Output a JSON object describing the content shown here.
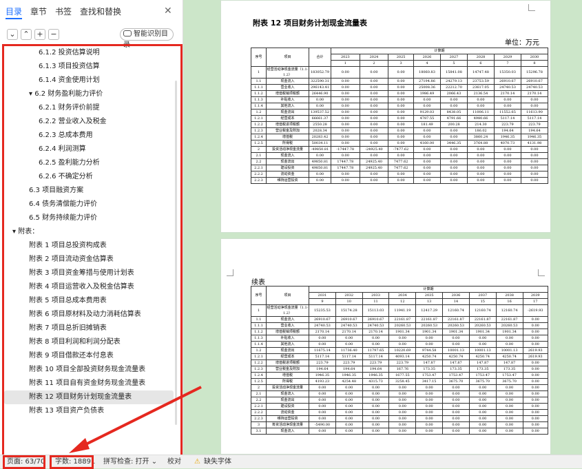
{
  "tabs": [
    "目录",
    "章节",
    "书签",
    "查找和替换"
  ],
  "tools": {
    "collapse": "⌄",
    "expand": "⌃",
    "add": "+",
    "remove": "−",
    "smart": "智能识别目录"
  },
  "outline": [
    {
      "t": "6.1.2 投资估算说明",
      "l": 3
    },
    {
      "t": "6.1.3 项目投资估算",
      "l": 3
    },
    {
      "t": "6.1.4 资金使用计划",
      "l": 3
    },
    {
      "t": "▾ 6.2 财务盈利能力评价",
      "l": 2
    },
    {
      "t": "6.2.1 财务评价前提",
      "l": 3
    },
    {
      "t": "6.2.2 营业收入及税金",
      "l": 3
    },
    {
      "t": "6.2.3 总成本费用",
      "l": 3
    },
    {
      "t": "6.2.4 利润测算",
      "l": 3
    },
    {
      "t": "6.2.5 盈利能力分析",
      "l": 3
    },
    {
      "t": "6.2.6 不确定分析",
      "l": 3
    },
    {
      "t": "6.3 项目融资方案",
      "l": 2
    },
    {
      "t": "6.4 债务清偿能力评价",
      "l": 2
    },
    {
      "t": "6.5 财务持续能力评价",
      "l": 2
    },
    {
      "t": "▾ 附表：",
      "l": 1
    },
    {
      "t": "附表 1 项目总投资构成表",
      "l": 2
    },
    {
      "t": "附表 2 项目流动资金估算表",
      "l": 2
    },
    {
      "t": "附表 3 项目资金筹措与使用计划表",
      "l": 2
    },
    {
      "t": "附表 4 项目运营收入及税金估算表",
      "l": 2
    },
    {
      "t": "附表 5 项目总成本费用表",
      "l": 2
    },
    {
      "t": "附表 6 项目原材料及动力消耗估算表",
      "l": 2
    },
    {
      "t": "附表 7 项目总折旧摊销表",
      "l": 2
    },
    {
      "t": "附表 8 项目利润和利润分配表",
      "l": 2
    },
    {
      "t": "附表 9 项目借款还本付息表",
      "l": 2
    },
    {
      "t": "附表 10 项目全部投资财务现金流量表",
      "l": 2
    },
    {
      "t": "附表 11 项目自有资金财务现金流量表",
      "l": 2
    },
    {
      "t": "附表 12 项目财务计划现金流量表",
      "l": 2,
      "sel": true
    },
    {
      "t": "附表 13 项目资产负债表",
      "l": 2
    }
  ],
  "status": {
    "page": "页面: 63/70",
    "words": "字数: 18891",
    "spell": "拼写检查: 打开 ⌄",
    "proof": "校对",
    "missing": "缺失字体"
  },
  "page1": {
    "title": "附表 12 项目财务计划现金流量表",
    "unit": "单位：万元",
    "calc_label": "计算期",
    "years": [
      "2023",
      "2024",
      "2025",
      "2026",
      "2027",
      "2028",
      "2029",
      "2030"
    ],
    "nums": [
      "1",
      "2",
      "3",
      "4",
      "5",
      "6",
      "7",
      "8"
    ],
    "h_seq": "序号",
    "h_item": "项目",
    "h_total": "合计",
    "rows": [
      [
        "1",
        "经营活动净现金流量（1.1-1.2）",
        "183052.79",
        "0.00",
        "0.00",
        "0.00",
        "18060.83",
        "15841.08",
        "14747.48",
        "15350.03",
        "15296.78"
      ],
      [
        "1.1",
        "现金流入",
        "322590.31",
        "0.00",
        "0.00",
        "0.00",
        "27194.86",
        "24279.13",
        "23753.59",
        "26910.67",
        "26910.67"
      ],
      [
        "1.1.1",
        "营业收入",
        "296143.41",
        "0.00",
        "0.00",
        "0.00",
        "25008.36",
        "22212.70",
        "23617.05",
        "24740.53",
        "24740.53"
      ],
      [
        "1.1.2",
        "增值税销项税额",
        "26446.90",
        "0.00",
        "0.00",
        "0.00",
        "1986.49",
        "2066.43",
        "2136.54",
        "2170.14",
        "2170.14"
      ],
      [
        "1.1.3",
        "补贴收入",
        "0.00",
        "0.00",
        "0.00",
        "0.00",
        "0.00",
        "0.00",
        "0.00",
        "0.00",
        "0.00"
      ],
      [
        "1.1.4",
        "其他流入",
        "0.00",
        "0.00",
        "0.00",
        "0.00",
        "0.00",
        "0.00",
        "0.00",
        "0.00",
        "0.00"
      ],
      [
        "1.2",
        "现金流出",
        "139537.52",
        "0.00",
        "0.00",
        "0.00",
        "9129.03",
        "8438.05",
        "11006.11",
        "11552.65",
        "11613.90"
      ],
      [
        "1.2.1",
        "经营成本",
        "66661.37",
        "0.00",
        "0.00",
        "0.00",
        "4787.55",
        "4791.66",
        "4980.66",
        "5117.14",
        "5117.14"
      ],
      [
        "1.2.2",
        "增值税进项税额",
        "2550.28",
        "0.00",
        "0.00",
        "0.00",
        "181.49",
        "200.28",
        "214.30",
        "223.79",
        "223.79"
      ],
      [
        "1.2.3",
        "营业税金及附加",
        "2028.34",
        "0.00",
        "0.00",
        "0.00",
        "0.00",
        "0.00",
        "186.02",
        "194.64",
        "194.64"
      ],
      [
        "1.2.4",
        "增值税",
        "20283.42",
        "0.00",
        "0.00",
        "0.00",
        "0.00",
        "0.00",
        "3860.24",
        "1946.35",
        "1946.35"
      ],
      [
        "1.2.5",
        "所得税",
        "50034.11",
        "0.00",
        "0.00",
        "0.00",
        "4160.00",
        "3446.35",
        "3764.88",
        "4070.73",
        "4131.98"
      ],
      [
        "2",
        "投资活动净现金流量",
        "-49850.81",
        "-17447.78",
        "-24925.40",
        "-7477.62",
        "0.00",
        "0.00",
        "0.00",
        "0.00",
        "0.00"
      ],
      [
        "2.1",
        "现金流入",
        "0.00",
        "0.00",
        "0.00",
        "0.00",
        "0.00",
        "0.00",
        "0.00",
        "0.00",
        "0.00"
      ],
      [
        "2.2",
        "现金流出",
        "49850.81",
        "17447.78",
        "24925.40",
        "7477.62",
        "0.00",
        "0.00",
        "0.00",
        "0.00",
        "0.00"
      ],
      [
        "2.2.1",
        "建设投资",
        "49850.81",
        "17447.78",
        "24925.40",
        "7477.62",
        "0.00",
        "0.00",
        "0.00",
        "0.00",
        "0.00"
      ],
      [
        "2.2.2",
        "流动资金",
        "0.00",
        "0.00",
        "0.00",
        "0.00",
        "0.00",
        "0.00",
        "0.00",
        "0.00",
        "0.00"
      ],
      [
        "2.2.3",
        "维持运营投资",
        "0.00",
        "0.00",
        "0.00",
        "0.00",
        "0.00",
        "0.00",
        "0.00",
        "0.00",
        "0.00"
      ]
    ]
  },
  "page2": {
    "cont": "续表",
    "calc_label": "计算期",
    "years": [
      "2031",
      "2032",
      "2033",
      "2034",
      "2035",
      "2036",
      "2037",
      "2038",
      "2039"
    ],
    "nums": [
      "9",
      "10",
      "11",
      "12",
      "13",
      "14",
      "15",
      "16",
      "17"
    ],
    "h_seq": "序号",
    "h_item": "项目",
    "rows": [
      [
        "1",
        "经营活动净现金流量（1.1-1.2）",
        "15235.53",
        "15174.28",
        "15113.03",
        "11941.19",
        "12417.29",
        "12160.74",
        "12160.74",
        "12160.74",
        "-2619.93"
      ],
      [
        "1.1",
        "现金流入",
        "26910.67",
        "26910.67",
        "26910.67",
        "22161.87",
        "22161.87",
        "22161.87",
        "22161.87",
        "22161.87",
        "0.00"
      ],
      [
        "1.1.1",
        "营业收入",
        "24740.53",
        "24740.53",
        "24740.53",
        "20260.53",
        "20260.53",
        "20260.53",
        "20260.53",
        "20260.53",
        "0.00"
      ],
      [
        "1.1.2",
        "增值税销项税额",
        "2170.14",
        "2170.14",
        "2170.14",
        "1901.34",
        "1901.34",
        "1901.34",
        "1901.34",
        "1901.34",
        "0.00"
      ],
      [
        "1.1.3",
        "补贴收入",
        "0.00",
        "0.00",
        "0.00",
        "0.00",
        "0.00",
        "0.00",
        "0.00",
        "0.00",
        "0.00"
      ],
      [
        "1.1.4",
        "其他流入",
        "0.00",
        "0.00",
        "0.00",
        "0.00",
        "0.00",
        "0.00",
        "0.00",
        "0.00",
        "0.00"
      ],
      [
        "1.2",
        "现金流出",
        "11675.14",
        "11736.40",
        "11797.65",
        "10220.69",
        "9744.58",
        "10001.13",
        "10001.13",
        "10001.13",
        "2619.93"
      ],
      [
        "1.2.1",
        "经营成本",
        "5117.14",
        "5117.14",
        "5117.14",
        "4093.14",
        "4250.74",
        "4250.74",
        "4250.74",
        "4250.74",
        "2619.93"
      ],
      [
        "1.2.2",
        "增值税进项税额",
        "223.79",
        "223.79",
        "223.79",
        "223.79",
        "147.87",
        "147.87",
        "147.87",
        "147.87",
        "0.00"
      ],
      [
        "1.2.3",
        "营业税金及附加",
        "194.64",
        "194.64",
        "194.64",
        "167.76",
        "173.35",
        "173.35",
        "173.35",
        "173.35",
        "0.00"
      ],
      [
        "1.2.4",
        "增值税",
        "1946.35",
        "1946.35",
        "1946.35",
        "1677.55",
        "1753.47",
        "1753.47",
        "1753.47",
        "1753.47",
        "0.00"
      ],
      [
        "1.2.5",
        "所得税",
        "4193.23",
        "4254.48",
        "4315.73",
        "3258.45",
        "3417.15",
        "3675.70",
        "3675.70",
        "3675.70",
        "0.00"
      ],
      [
        "2",
        "投资活动净现金流量",
        "0.00",
        "0.00",
        "0.00",
        "0.00",
        "0.00",
        "0.00",
        "0.00",
        "0.00",
        "0.00"
      ],
      [
        "2.1",
        "现金流入",
        "0.00",
        "0.00",
        "0.00",
        "0.00",
        "0.00",
        "0.00",
        "0.00",
        "0.00",
        "0.00"
      ],
      [
        "2.2",
        "现金流出",
        "0.00",
        "0.00",
        "0.00",
        "0.00",
        "0.00",
        "0.00",
        "0.00",
        "0.00",
        "0.00"
      ],
      [
        "2.2.1",
        "建设投资",
        "0.00",
        "0.00",
        "0.00",
        "0.00",
        "0.00",
        "0.00",
        "0.00",
        "0.00",
        "0.00"
      ],
      [
        "2.2.2",
        "流动资金",
        "0.00",
        "0.00",
        "0.00",
        "0.00",
        "0.00",
        "0.00",
        "0.00",
        "0.00",
        "0.00"
      ],
      [
        "2.2.3",
        "维持运营投资",
        "0.00",
        "0.00",
        "0.00",
        "0.00",
        "0.00",
        "0.00",
        "0.00",
        "0.00",
        "0.00"
      ],
      [
        "3",
        "筹资活动净现金流量",
        "-5490.00",
        "0.00",
        "0.00",
        "0.00",
        "0.00",
        "0.00",
        "0.00",
        "0.00",
        "0.00"
      ],
      [
        "3.1",
        "现金流入",
        "0.00",
        "0.00",
        "0.00",
        "0.00",
        "0.00",
        "0.00",
        "0.00",
        "0.00",
        "0.00"
      ]
    ]
  }
}
